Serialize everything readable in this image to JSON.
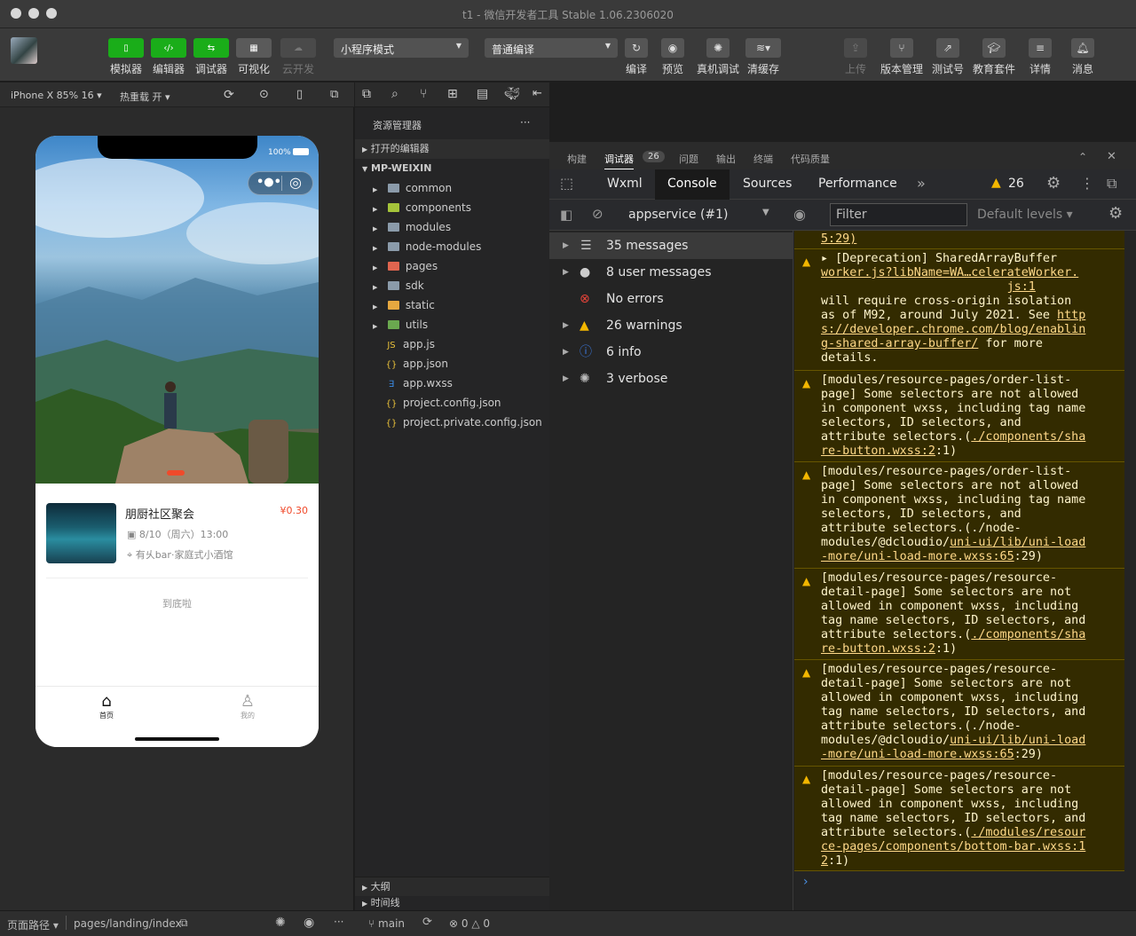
{
  "window": {
    "title": "t1 - 微信开发者工具 Stable 1.06.2306020"
  },
  "toolbar": {
    "left_buttons": [
      {
        "label": "模拟器",
        "icon": "phone-icon"
      },
      {
        "label": "编辑器",
        "icon": "code-icon"
      },
      {
        "label": "调试器",
        "icon": "debug-icon"
      },
      {
        "label": "可视化",
        "icon": "layout-icon"
      },
      {
        "label": "云开发",
        "icon": "cloud-icon"
      }
    ],
    "mode_select": "小程序模式",
    "compile_select": "普通编译",
    "mid_buttons": [
      {
        "label": "编译",
        "icon": "refresh-icon"
      },
      {
        "label": "预览",
        "icon": "eye-icon"
      },
      {
        "label": "真机调试",
        "icon": "bug-icon"
      },
      {
        "label": "清缓存",
        "icon": "layers-icon"
      }
    ],
    "right_buttons": [
      {
        "label": "上传",
        "icon": "upload-icon"
      },
      {
        "label": "版本管理",
        "icon": "branch-icon"
      },
      {
        "label": "测试号",
        "icon": "external-icon"
      },
      {
        "label": "教育套件",
        "icon": "graduation-icon"
      },
      {
        "label": "详情",
        "icon": "menu-icon"
      },
      {
        "label": "消息",
        "icon": "bell-icon"
      }
    ]
  },
  "simulator": {
    "device": "iPhone X 85% 16",
    "hot_reload": "热重载 开",
    "battery": "100%",
    "event": {
      "title": "朋厨社区聚会",
      "price": "¥0.30",
      "datetime": "8/10（周六）13:00",
      "location": "有乆bar·家庭式小酒馆"
    },
    "end_text": "到底啦",
    "tabs": [
      {
        "label": "首页"
      },
      {
        "label": "我的"
      }
    ]
  },
  "explorer": {
    "title": "资源管理器",
    "more": "···",
    "open_editors": "打开的编辑器",
    "project": "MP-WEIXIN",
    "folders": [
      "common",
      "components",
      "modules",
      "node-modules",
      "pages",
      "sdk",
      "static",
      "utils"
    ],
    "files": [
      "app.js",
      "app.json",
      "app.wxss",
      "project.config.json",
      "project.private.config.json"
    ],
    "outline": "大纲",
    "timeline": "时间线"
  },
  "debugger": {
    "top_tabs": [
      "构建",
      "调试器",
      "问题",
      "输出",
      "终端",
      "代码质量"
    ],
    "badge": "26",
    "devtools_tabs": [
      "Wxml",
      "Console",
      "Sources",
      "Performance"
    ],
    "more_tabs": "»",
    "warn_count": "26",
    "context": "appservice (#1)",
    "filter_placeholder": "Filter",
    "levels": "Default levels",
    "sidebar": [
      {
        "label": "35 messages",
        "icon": "list-icon"
      },
      {
        "label": "8 user messages",
        "icon": "user-icon"
      },
      {
        "label": "No errors",
        "icon": "error-icon"
      },
      {
        "label": "26 warnings",
        "icon": "warning-icon"
      },
      {
        "label": "6 info",
        "icon": "info-icon"
      },
      {
        "label": "3 verbose",
        "icon": "verbose-icon"
      }
    ],
    "log_top_fragment": "5:29)",
    "prompt": "›"
  },
  "statusbar": {
    "path_label": "页面路径",
    "path": "pages/landing/index",
    "branch": "main",
    "errors": "0",
    "warnings": "0"
  },
  "colors": {
    "green": "#1aad19",
    "price": "#f04a2b",
    "warn_bg": "#332b00"
  }
}
